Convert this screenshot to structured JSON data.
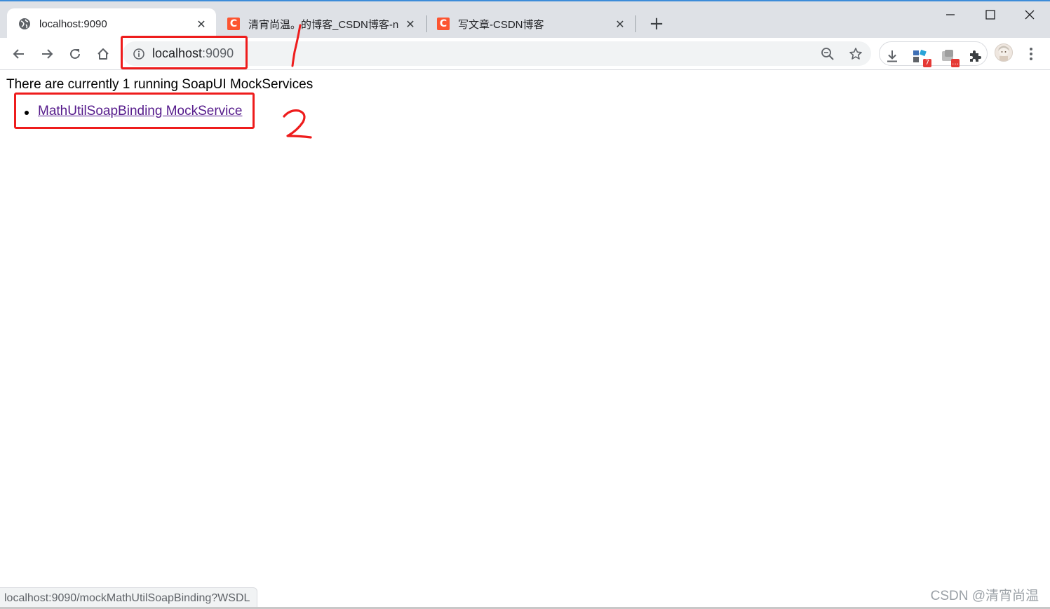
{
  "tabs": [
    {
      "title": "localhost:9090",
      "favicon": "globe-icon",
      "active": true
    },
    {
      "title": "清宵尚温。的博客_CSDN博客-n",
      "favicon": "csdn-c-icon",
      "active": false
    },
    {
      "title": "写文章-CSDN博客",
      "favicon": "csdn-c-icon",
      "active": false
    }
  ],
  "csdn_favicon_letter": "C",
  "new_tab_symbol": "+",
  "window_controls": {
    "minimize": "—",
    "maximize": "☐",
    "close": "✕"
  },
  "tab_close_symbol": "✕",
  "address_bar": {
    "host": "localhost",
    "port": ":9090"
  },
  "extensions": {
    "badge_count": "7",
    "badge_dots": "…"
  },
  "page": {
    "running_text": "There are currently 1 running SoapUI MockServices",
    "services": [
      "MathUtilSoapBinding MockService"
    ]
  },
  "status_bar": {
    "url": "localhost:9090/mockMathUtilSoapBinding?WSDL"
  },
  "watermark": "CSDN @清宵尚温",
  "colors": {
    "annotation": "#ee1c1c",
    "visited_link": "#551a8b",
    "csdn_brand": "#fc5531",
    "tab_strip": "#dee1e6"
  }
}
